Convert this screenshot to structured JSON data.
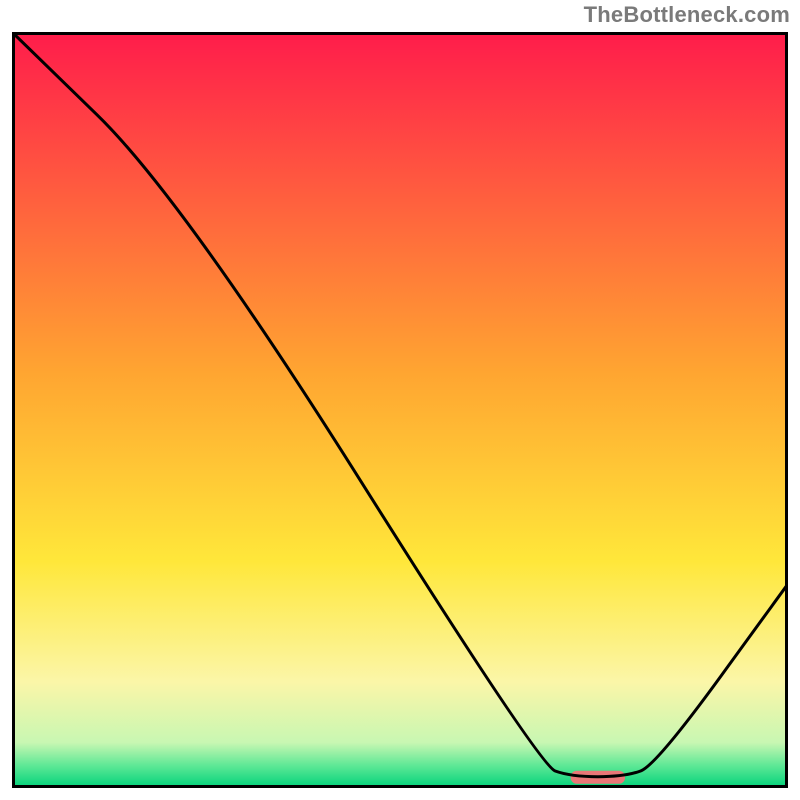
{
  "watermark": "TheBottleneck.com",
  "chart_data": {
    "type": "line",
    "title": "",
    "xlabel": "",
    "ylabel": "",
    "x_range": [
      0,
      100
    ],
    "y_range": [
      0,
      100
    ],
    "curve": [
      {
        "x": 0,
        "y": 100
      },
      {
        "x": 22,
        "y": 78
      },
      {
        "x": 68,
        "y": 3
      },
      {
        "x": 72,
        "y": 1.5
      },
      {
        "x": 79,
        "y": 1.5
      },
      {
        "x": 83,
        "y": 3
      },
      {
        "x": 100,
        "y": 27
      }
    ],
    "marker": {
      "x_start": 72,
      "x_end": 79,
      "y": 1.5,
      "color": "#e97777"
    },
    "gradient_stops": [
      {
        "offset": 0.0,
        "color": "#ff1c4b"
      },
      {
        "offset": 0.45,
        "color": "#ffa531"
      },
      {
        "offset": 0.7,
        "color": "#ffe73a"
      },
      {
        "offset": 0.86,
        "color": "#fbf6a8"
      },
      {
        "offset": 0.94,
        "color": "#c8f7b2"
      },
      {
        "offset": 0.97,
        "color": "#5fe896"
      },
      {
        "offset": 1.0,
        "color": "#00d27a"
      }
    ],
    "border_color": "#000000",
    "curve_color": "#000000"
  }
}
